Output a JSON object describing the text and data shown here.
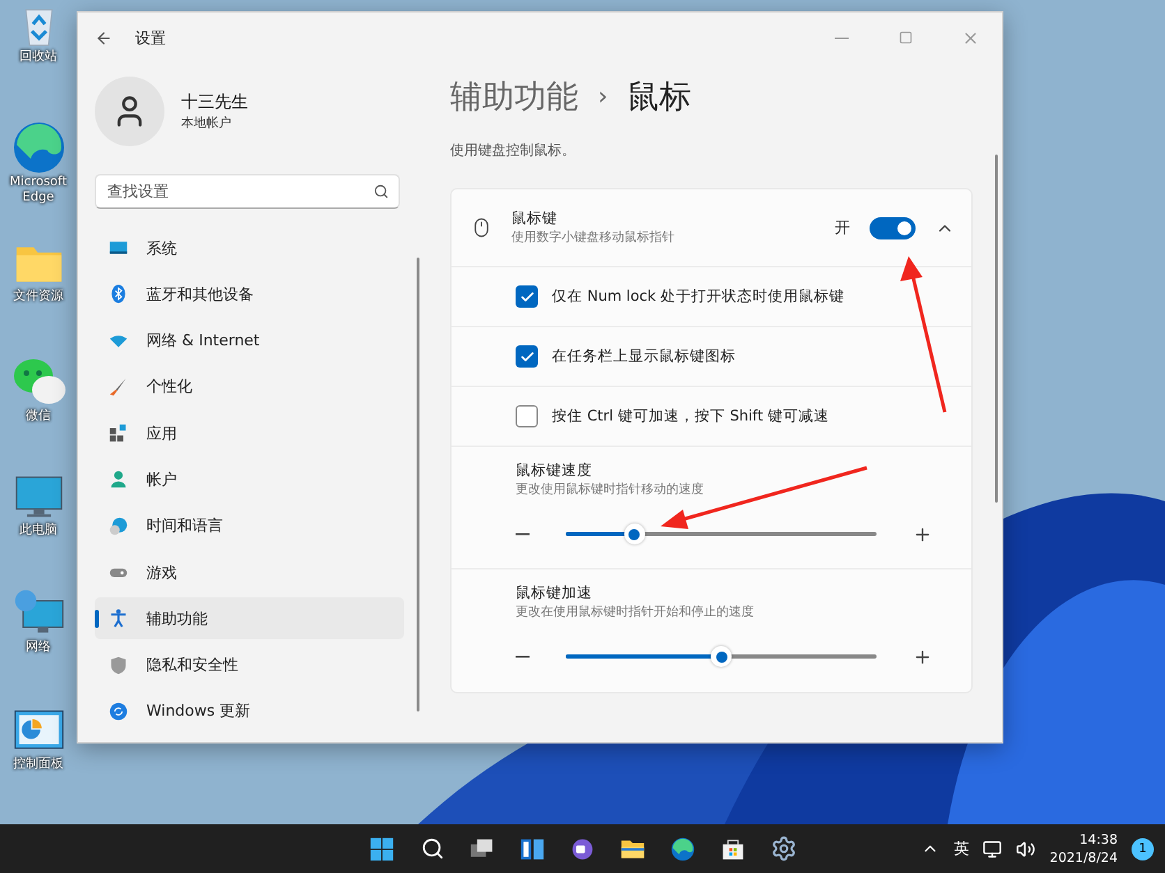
{
  "desktop_icons": [
    {
      "label": "回收站"
    },
    {
      "label": "Microsoft Edge"
    },
    {
      "label": "文件资源"
    },
    {
      "label": "微信"
    },
    {
      "label": "此电脑"
    },
    {
      "label": "网络"
    },
    {
      "label": "控制面板"
    }
  ],
  "window": {
    "title": "设置",
    "user": {
      "name": "十三先生",
      "account": "本地帐户"
    },
    "search": {
      "placeholder": "查找设置"
    },
    "nav": [
      {
        "label": "系统",
        "selected": false
      },
      {
        "label": "蓝牙和其他设备",
        "selected": false
      },
      {
        "label": "网络 & Internet",
        "selected": false
      },
      {
        "label": "个性化",
        "selected": false
      },
      {
        "label": "应用",
        "selected": false
      },
      {
        "label": "帐户",
        "selected": false
      },
      {
        "label": "时间和语言",
        "selected": false
      },
      {
        "label": "游戏",
        "selected": false
      },
      {
        "label": "辅助功能",
        "selected": true
      },
      {
        "label": "隐私和安全性",
        "selected": false
      },
      {
        "label": "Windows 更新",
        "selected": false
      }
    ],
    "breadcrumb": {
      "parent": "辅助功能",
      "separator": "›",
      "current": "鼠标"
    },
    "description": "使用键盘控制鼠标。",
    "mouse_keys": {
      "title": "鼠标键",
      "subtitle": "使用数字小键盘移动鼠标指针",
      "state_label": "开",
      "on": true,
      "expanded": true,
      "options": [
        {
          "label": "仅在 Num lock 处于打开状态时使用鼠标键",
          "checked": true
        },
        {
          "label": "在任务栏上显示鼠标键图标",
          "checked": true
        },
        {
          "label": "按住 Ctrl 键可加速，按下 Shift 键可减速",
          "checked": false
        }
      ],
      "sliders": [
        {
          "title": "鼠标键速度",
          "subtitle": "更改使用鼠标键时指针移动的速度",
          "level": 0.22
        },
        {
          "title": "鼠标键加速",
          "subtitle": "更改在使用鼠标键时指针开始和停止的速度",
          "level": 0.5
        }
      ]
    }
  },
  "taskbar": {
    "language": "英",
    "time": "14:38",
    "date": "2021/8/24",
    "notification_count": "1"
  }
}
